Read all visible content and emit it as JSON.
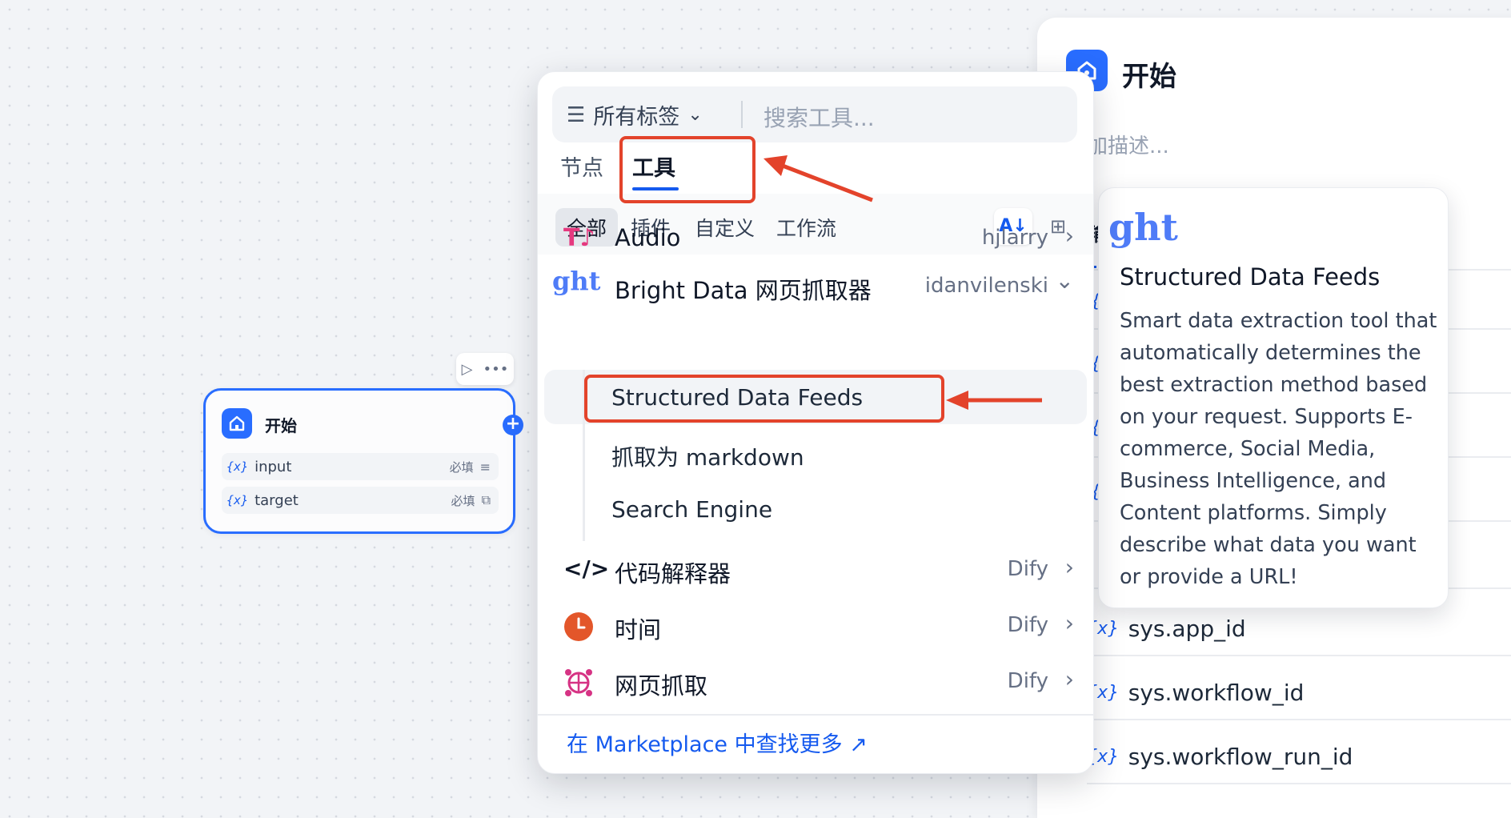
{
  "panel": {
    "title": "开始",
    "description_placeholder": "加描述...",
    "tab_partial": "输",
    "vars": [
      "sys.app_id",
      "sys.workflow_id",
      "sys.workflow_run_id"
    ]
  },
  "tooltip": {
    "logo_text": "ght",
    "title": "Structured Data Feeds",
    "description": "Smart data extraction tool that automatically determines the best extraction method based on your request. Supports E-commerce, Social Media, Business Intelligence, and Content platforms. Simply describe what data you want or provide a URL!"
  },
  "node": {
    "title": "开始",
    "vars": [
      {
        "prefix": "{x}",
        "name": "input",
        "required": "必填"
      },
      {
        "prefix": "{x}",
        "name": "target",
        "required": "必填"
      }
    ]
  },
  "popup": {
    "filter_label": "所有标签",
    "search_placeholder": "搜索工具...",
    "tabs": [
      "节点",
      "工具"
    ],
    "categories": [
      "全部",
      "插件",
      "自定义",
      "工作流"
    ],
    "items": [
      {
        "label": "Audio",
        "author": "hjlarry",
        "chevron": "›"
      },
      {
        "label": "Bright Data 网页抓取器",
        "author": "idanvilenski",
        "chevron": "⌄",
        "logo": "ght"
      },
      {
        "label": "代码解释器",
        "author": "Dify",
        "chevron": "›",
        "icon": "</>"
      },
      {
        "label": "时间",
        "author": "Dify",
        "chevron": "›"
      },
      {
        "label": "网页抓取",
        "author": "Dify",
        "chevron": "›"
      }
    ],
    "sub_items": [
      "Structured Data Feeds",
      "抓取为 markdown",
      "Search Engine"
    ],
    "footer_link": "在 Marketplace 中查找更多 ↗"
  },
  "colors": {
    "accent": "#155aef",
    "annotation_red": "#e3432b"
  }
}
